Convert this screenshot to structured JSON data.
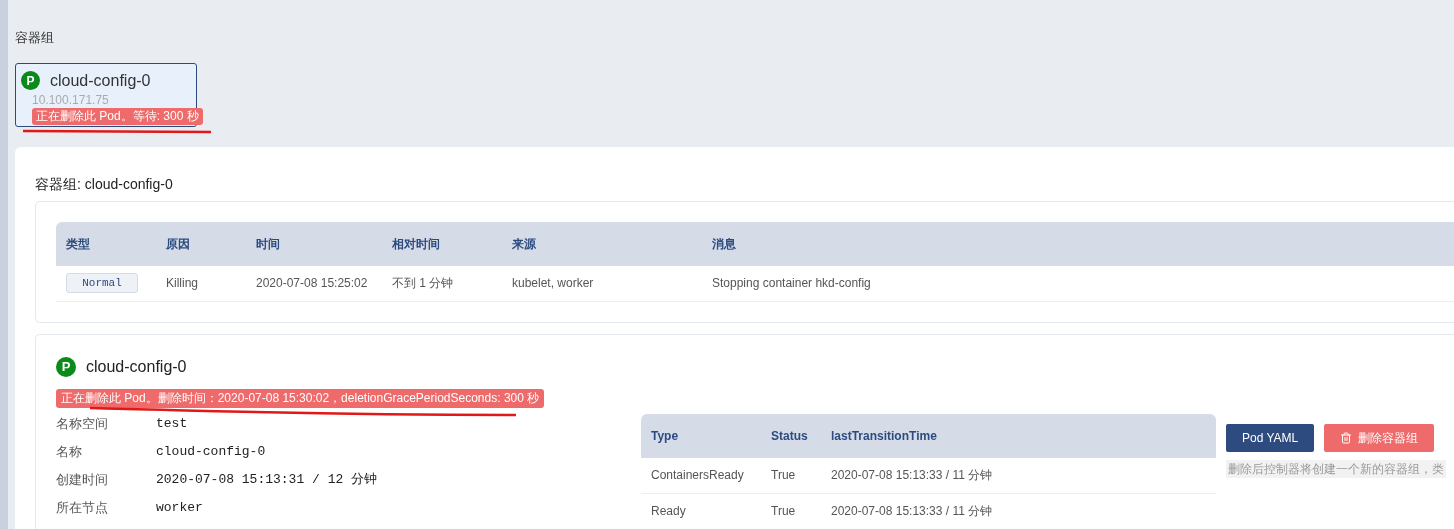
{
  "section_title": "容器组",
  "pod_card": {
    "status_letter": "P",
    "name": "cloud-config-0",
    "ip": "10.100.171.75",
    "warning": "正在删除此 Pod。等待: 300 秒",
    "selected": true
  },
  "detail_panel": {
    "title": "容器组: cloud-config-0",
    "events": {
      "columns": [
        "类型",
        "原因",
        "时间",
        "相对时间",
        "来源",
        "消息"
      ],
      "rows": [
        {
          "type": "Normal",
          "reason": "Killing",
          "time": "2020-07-08 15:25:02",
          "relative": "不到 1 分钟",
          "source": "kubelet, worker",
          "message": "Stopping container hkd-config"
        }
      ]
    },
    "pod": {
      "status_letter": "P",
      "name": "cloud-config-0",
      "warning": "正在删除此 Pod。删除时间：2020-07-08 15:30:02，deletionGracePeriodSeconds: 300 秒",
      "fields": [
        {
          "label": "名称空间",
          "value": "test"
        },
        {
          "label": "名称",
          "value": "cloud-config-0"
        },
        {
          "label": "创建时间",
          "value": "2020-07-08 15:13:31 / 12 分钟"
        },
        {
          "label": "所在节点",
          "value": "worker"
        }
      ],
      "conditions": {
        "columns": [
          "Type",
          "Status",
          "lastTransitionTime"
        ],
        "rows": [
          {
            "type": "ContainersReady",
            "status": "True",
            "time": "2020-07-08 15:13:33 / 11 分钟"
          },
          {
            "type": "Ready",
            "status": "True",
            "time": "2020-07-08 15:13:33 / 11 分钟"
          }
        ]
      },
      "buttons": [
        {
          "kind": "primary",
          "label": "Pod YAML"
        },
        {
          "kind": "danger",
          "label": "删除容器组"
        }
      ],
      "hint": "删除后控制器将创建一个新的容器组，类"
    }
  }
}
